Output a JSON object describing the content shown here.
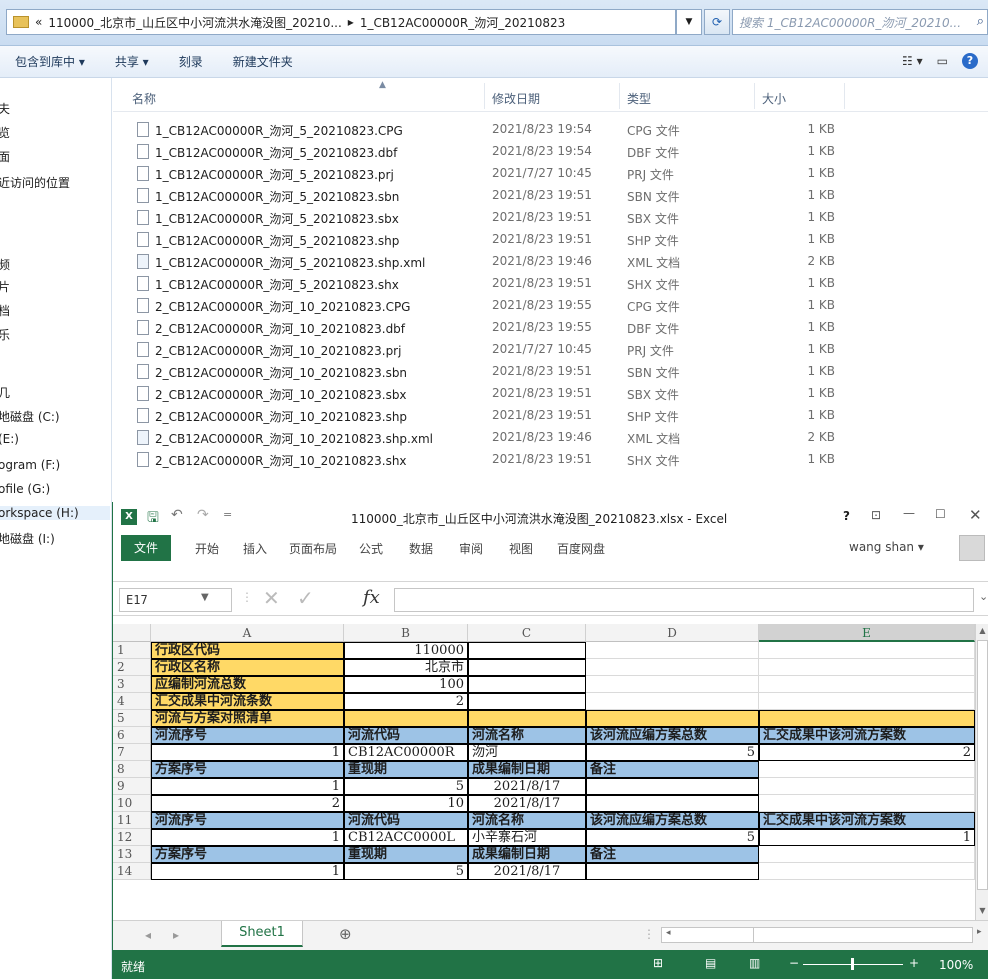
{
  "explorer": {
    "address": {
      "prefix": "«",
      "segments": [
        "110000_北京市_山丘区中小河流洪水淹没图_20210...",
        "▸",
        "1_CB12AC00000R_沕河_20210823"
      ]
    },
    "search_placeholder": "搜索 1_CB12AC00000R_沕河_20210...",
    "toolbar": [
      "包含到库中 ▾",
      "共享 ▾",
      "刻录",
      "新建文件夹"
    ],
    "nav_items": [
      "夫",
      "览",
      "面",
      "近访问的位置",
      "频",
      "片",
      "档",
      "乐",
      "几",
      "地磁盘 (C:)",
      "(E:)",
      "ogram (F:)",
      "ofile (G:)",
      "orkspace (H:)",
      "地磁盘 (I:)"
    ],
    "columns": {
      "name": "名称",
      "date": "修改日期",
      "type": "类型",
      "size": "大小"
    },
    "files": [
      {
        "name": "1_CB12AC00000R_沕河_5_20210823.CPG",
        "date": "2021/8/23 19:54",
        "type": "CPG 文件",
        "size": "1 KB",
        "icon": "file-icon"
      },
      {
        "name": "1_CB12AC00000R_沕河_5_20210823.dbf",
        "date": "2021/8/23 19:54",
        "type": "DBF 文件",
        "size": "1 KB",
        "icon": "file-icon"
      },
      {
        "name": "1_CB12AC00000R_沕河_5_20210823.prj",
        "date": "2021/7/27 10:45",
        "type": "PRJ 文件",
        "size": "1 KB",
        "icon": "file-icon"
      },
      {
        "name": "1_CB12AC00000R_沕河_5_20210823.sbn",
        "date": "2021/8/23 19:51",
        "type": "SBN 文件",
        "size": "1 KB",
        "icon": "file-icon"
      },
      {
        "name": "1_CB12AC00000R_沕河_5_20210823.sbx",
        "date": "2021/8/23 19:51",
        "type": "SBX 文件",
        "size": "1 KB",
        "icon": "file-icon"
      },
      {
        "name": "1_CB12AC00000R_沕河_5_20210823.shp",
        "date": "2021/8/23 19:51",
        "type": "SHP 文件",
        "size": "1 KB",
        "icon": "file-icon"
      },
      {
        "name": "1_CB12AC00000R_沕河_5_20210823.shp.xml",
        "date": "2021/8/23 19:46",
        "type": "XML 文档",
        "size": "2 KB",
        "icon": "xml-file-icon"
      },
      {
        "name": "1_CB12AC00000R_沕河_5_20210823.shx",
        "date": "2021/8/23 19:51",
        "type": "SHX 文件",
        "size": "1 KB",
        "icon": "file-icon"
      },
      {
        "name": "2_CB12AC00000R_沕河_10_20210823.CPG",
        "date": "2021/8/23 19:55",
        "type": "CPG 文件",
        "size": "1 KB",
        "icon": "file-icon"
      },
      {
        "name": "2_CB12AC00000R_沕河_10_20210823.dbf",
        "date": "2021/8/23 19:55",
        "type": "DBF 文件",
        "size": "1 KB",
        "icon": "file-icon"
      },
      {
        "name": "2_CB12AC00000R_沕河_10_20210823.prj",
        "date": "2021/7/27 10:45",
        "type": "PRJ 文件",
        "size": "1 KB",
        "icon": "file-icon"
      },
      {
        "name": "2_CB12AC00000R_沕河_10_20210823.sbn",
        "date": "2021/8/23 19:51",
        "type": "SBN 文件",
        "size": "1 KB",
        "icon": "file-icon"
      },
      {
        "name": "2_CB12AC00000R_沕河_10_20210823.sbx",
        "date": "2021/8/23 19:51",
        "type": "SBX 文件",
        "size": "1 KB",
        "icon": "file-icon"
      },
      {
        "name": "2_CB12AC00000R_沕河_10_20210823.shp",
        "date": "2021/8/23 19:51",
        "type": "SHP 文件",
        "size": "1 KB",
        "icon": "file-icon"
      },
      {
        "name": "2_CB12AC00000R_沕河_10_20210823.shp.xml",
        "date": "2021/8/23 19:46",
        "type": "XML 文档",
        "size": "2 KB",
        "icon": "xml-file-icon"
      },
      {
        "name": "2_CB12AC00000R_沕河_10_20210823.shx",
        "date": "2021/8/23 19:51",
        "type": "SHX 文件",
        "size": "1 KB",
        "icon": "file-icon"
      }
    ]
  },
  "excel": {
    "title": "110000_北京市_山丘区中小河流洪水淹没图_20210823.xlsx - Excel",
    "help": "?",
    "file_tab": "文件",
    "tabs": [
      "开始",
      "插入",
      "页面布局",
      "公式",
      "数据",
      "审阅",
      "视图",
      "百度网盘"
    ],
    "user": "wang shan ▾",
    "name_box": "E17",
    "fx": "fx",
    "columns": [
      "A",
      "B",
      "C",
      "D",
      "E"
    ],
    "rows": [
      [
        {
          "t": "行政区代码",
          "s": "yl b"
        },
        {
          "t": "110000",
          "s": "bx r"
        },
        {
          "t": "",
          "s": "bx"
        },
        {
          "t": "",
          "s": ""
        },
        {
          "t": "",
          "s": ""
        }
      ],
      [
        {
          "t": "行政区名称",
          "s": "yl b"
        },
        {
          "t": "北京市",
          "s": "bx r"
        },
        {
          "t": "",
          "s": "bx"
        },
        {
          "t": "",
          "s": ""
        },
        {
          "t": "",
          "s": ""
        }
      ],
      [
        {
          "t": "应编制河流总数",
          "s": "yl b"
        },
        {
          "t": "100",
          "s": "bx r"
        },
        {
          "t": "",
          "s": "bx"
        },
        {
          "t": "",
          "s": ""
        },
        {
          "t": "",
          "s": ""
        }
      ],
      [
        {
          "t": "汇交成果中河流条数",
          "s": "yl b"
        },
        {
          "t": "2",
          "s": "bx r"
        },
        {
          "t": "",
          "s": "bx"
        },
        {
          "t": "",
          "s": ""
        },
        {
          "t": "",
          "s": ""
        }
      ],
      [
        {
          "t": "河流与方案对照清单",
          "s": "yl b"
        },
        {
          "t": "",
          "s": "yl"
        },
        {
          "t": "",
          "s": "yl"
        },
        {
          "t": "",
          "s": "yl"
        },
        {
          "t": "",
          "s": "yl"
        }
      ],
      [
        {
          "t": "河流序号",
          "s": "bl b"
        },
        {
          "t": "河流代码",
          "s": "bl b"
        },
        {
          "t": "河流名称",
          "s": "bl b"
        },
        {
          "t": "该河流应编方案总数",
          "s": "bl b"
        },
        {
          "t": "汇交成果中该河流方案数",
          "s": "bl b"
        }
      ],
      [
        {
          "t": "1",
          "s": "bx r"
        },
        {
          "t": "CB12AC00000R",
          "s": "bx"
        },
        {
          "t": "沕河",
          "s": "bx"
        },
        {
          "t": "5",
          "s": "bx r"
        },
        {
          "t": "2",
          "s": "bx r"
        }
      ],
      [
        {
          "t": "方案序号",
          "s": "bl b"
        },
        {
          "t": "重现期",
          "s": "bl b"
        },
        {
          "t": "成果编制日期",
          "s": "bl b"
        },
        {
          "t": "备注",
          "s": "bl b"
        },
        {
          "t": "",
          "s": ""
        }
      ],
      [
        {
          "t": "1",
          "s": "bx r"
        },
        {
          "t": "5",
          "s": "bx r"
        },
        {
          "t": "2021/8/17",
          "s": "bx c"
        },
        {
          "t": "",
          "s": "bx"
        },
        {
          "t": "",
          "s": ""
        }
      ],
      [
        {
          "t": "2",
          "s": "bx r"
        },
        {
          "t": "10",
          "s": "bx r"
        },
        {
          "t": "2021/8/17",
          "s": "bx c"
        },
        {
          "t": "",
          "s": "bx"
        },
        {
          "t": "",
          "s": ""
        }
      ],
      [
        {
          "t": "河流序号",
          "s": "bl b"
        },
        {
          "t": "河流代码",
          "s": "bl b"
        },
        {
          "t": "河流名称",
          "s": "bl b"
        },
        {
          "t": "该河流应编方案总数",
          "s": "bl b"
        },
        {
          "t": "汇交成果中该河流方案数",
          "s": "bl b"
        }
      ],
      [
        {
          "t": "1",
          "s": "bx r"
        },
        {
          "t": "CB12ACC0000L",
          "s": "bx"
        },
        {
          "t": "小辛寨石河",
          "s": "bx"
        },
        {
          "t": "5",
          "s": "bx r"
        },
        {
          "t": "1",
          "s": "bx r"
        }
      ],
      [
        {
          "t": "方案序号",
          "s": "bl b"
        },
        {
          "t": "重现期",
          "s": "bl b"
        },
        {
          "t": "成果编制日期",
          "s": "bl b"
        },
        {
          "t": "备注",
          "s": "bl b"
        },
        {
          "t": "",
          "s": ""
        }
      ],
      [
        {
          "t": "1",
          "s": "bx r"
        },
        {
          "t": "5",
          "s": "bx r"
        },
        {
          "t": "2021/8/17",
          "s": "bx c"
        },
        {
          "t": "",
          "s": "bx"
        },
        {
          "t": "",
          "s": ""
        }
      ]
    ],
    "sheet": "Sheet1",
    "status": "就绪",
    "zoom": "100%"
  }
}
